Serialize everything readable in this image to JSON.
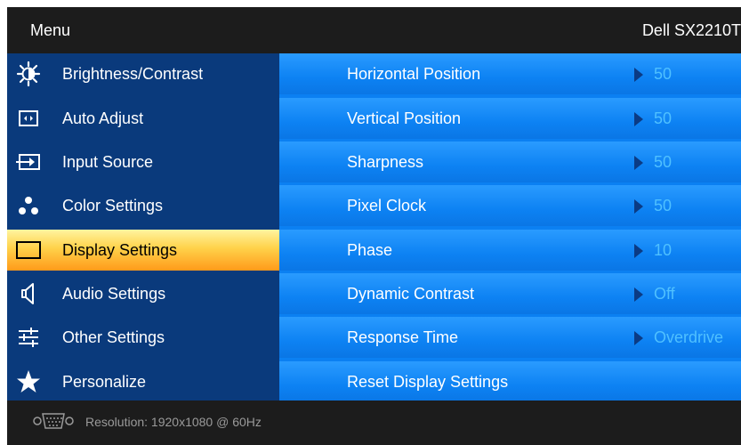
{
  "header": {
    "title": "Menu",
    "model": "Dell SX2210T"
  },
  "sidebar": {
    "items": [
      {
        "label": "Brightness/Contrast",
        "icon": "brightness-icon"
      },
      {
        "label": "Auto Adjust",
        "icon": "auto-adjust-icon"
      },
      {
        "label": "Input Source",
        "icon": "input-source-icon"
      },
      {
        "label": "Color Settings",
        "icon": "color-settings-icon"
      },
      {
        "label": "Display Settings",
        "icon": "display-settings-icon",
        "selected": true
      },
      {
        "label": "Audio Settings",
        "icon": "speaker-icon"
      },
      {
        "label": "Other Settings",
        "icon": "other-settings-icon"
      },
      {
        "label": "Personalize",
        "icon": "star-icon"
      }
    ]
  },
  "settings": {
    "rows": [
      {
        "label": "Horizontal Position",
        "value": "50"
      },
      {
        "label": "Vertical Position",
        "value": "50"
      },
      {
        "label": "Sharpness",
        "value": "50"
      },
      {
        "label": "Pixel Clock",
        "value": "50"
      },
      {
        "label": "Phase",
        "value": "10"
      },
      {
        "label": "Dynamic Contrast",
        "value": "Off"
      },
      {
        "label": "Response Time",
        "value": "Overdrive"
      },
      {
        "label": "Reset Display Settings"
      }
    ]
  },
  "footer": {
    "status": "Resolution: 1920x1080 @ 60Hz",
    "icon": "vga-connector-icon"
  },
  "colors": {
    "background": "#1c1c1c",
    "sidebar": "#0a3a7c",
    "content": "#0b80f2",
    "selected_highlight": "#ffb22a",
    "value_text": "#4fc0ff",
    "arrow": "#0b3b84"
  }
}
